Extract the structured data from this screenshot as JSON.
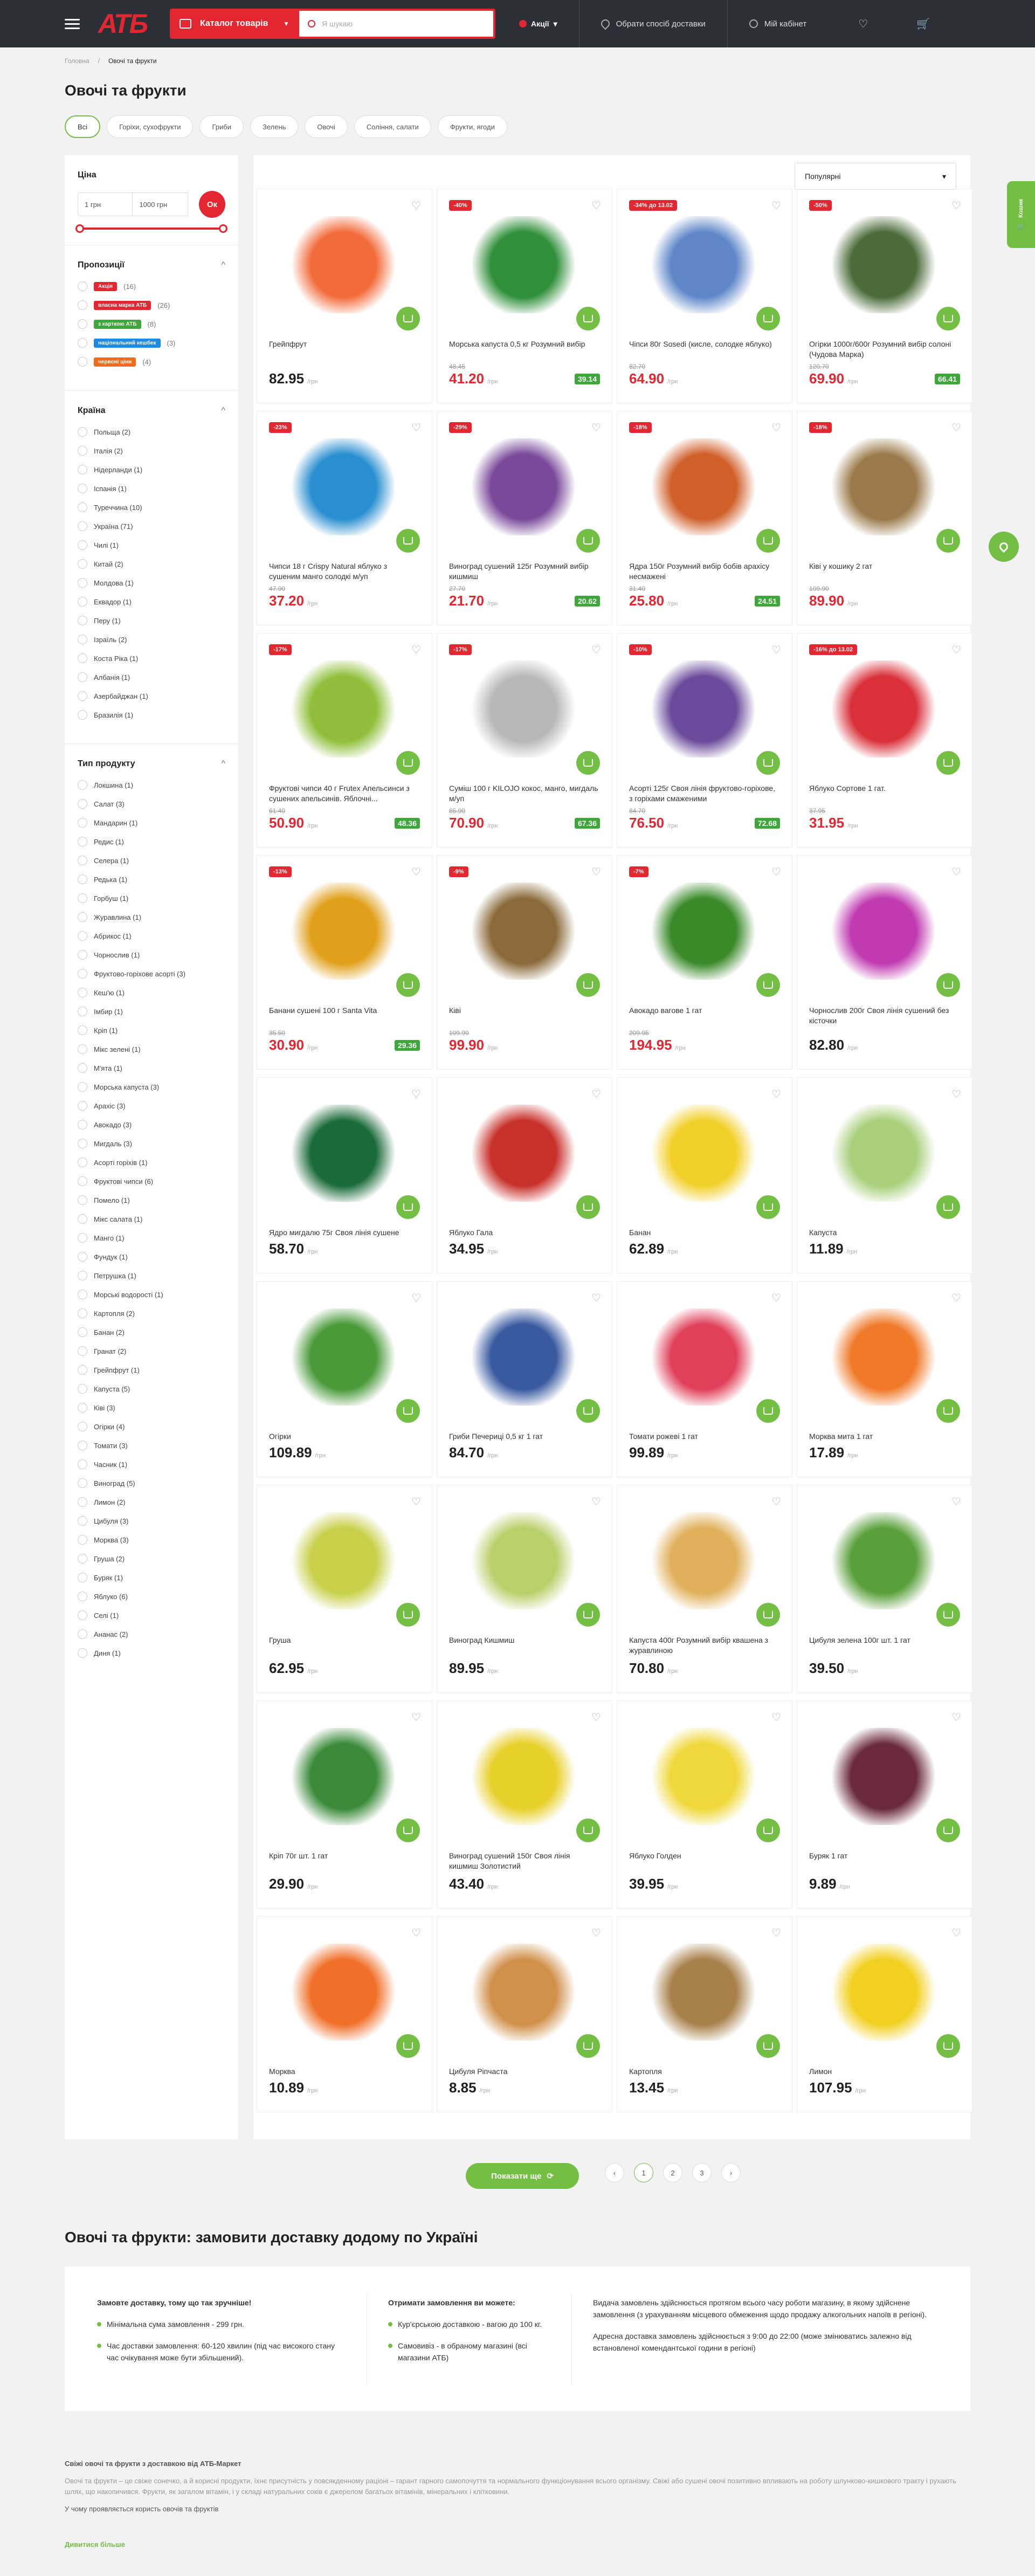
{
  "header": {
    "catalog": "Каталог товарів",
    "search_placeholder": "Я шукаю",
    "promo": "Акції",
    "delivery": "Обрати спосіб доставки",
    "account": "Мій кабінет"
  },
  "breadcrumb": {
    "home": "Головна",
    "current": "Овочі та фрукти"
  },
  "page_title": "Овочі та фрукти",
  "chips": [
    "Всі",
    "Горіхи, сухофрукти",
    "Гриби",
    "Зелень",
    "Овочі",
    "Соління, салати",
    "Фрукти, ягоди"
  ],
  "filters": {
    "price": {
      "title": "Ціна",
      "from": "1 грн",
      "to": "1000 грн",
      "ok": "Ок"
    },
    "offers": {
      "title": "Пропозиції",
      "items": [
        {
          "label": "Акція",
          "count": "(16)"
        },
        {
          "label": "власна марка АТБ",
          "count": "(26)"
        },
        {
          "label": "з карткою АТБ",
          "count": "(8)"
        },
        {
          "label": "національний кешбек",
          "count": "(3)"
        },
        {
          "label": "червоні ціни",
          "count": "(4)"
        }
      ]
    },
    "country": {
      "title": "Країна",
      "items": [
        "Польща (2)",
        "Італія (2)",
        "Нідерланди (1)",
        "Іспанія (1)",
        "Туреччина (10)",
        "Україна (71)",
        "Чилі (1)",
        "Китай (2)",
        "Молдова (1)",
        "Еквадор (1)",
        "Перу (1)",
        "Ізраїль (2)",
        "Коста Ріка (1)",
        "Албанія (1)",
        "Азербайджан (1)",
        "Бразилія (1)"
      ]
    },
    "type": {
      "title": "Тип продукту",
      "items": [
        "Локшина (1)",
        "Салат (3)",
        "Мандарин (1)",
        "Редис (1)",
        "Селера (1)",
        "Редька (1)",
        "Горбуш (1)",
        "Журавлина (1)",
        "Абрикос (1)",
        "Чорнослив (1)",
        "Фруктово-горіхове асорті (3)",
        "Кеш'ю (1)",
        "Імбир (1)",
        "Кріп (1)",
        "Мікс зелені (1)",
        "М'ята (1)",
        "Морська капуста (3)",
        "Арахіс (3)",
        "Авокадо (3)",
        "Мигдаль (3)",
        "Асорті горіхів (1)",
        "Фруктові чипси (6)",
        "Помело (1)",
        "Мікс салата (1)",
        "Манго (1)",
        "Фундук (1)",
        "Петрушка (1)",
        "Морські водорості (1)",
        "Картопля (2)",
        "Банан (2)",
        "Гранат (2)",
        "Грейпфрут (1)",
        "Капуста (5)",
        "Ківі (3)",
        "Огірки (4)",
        "Томати (3)",
        "Часник (1)",
        "Виноград (5)",
        "Лимон (2)",
        "Цибуля (3)",
        "Морква (3)",
        "Груша (2)",
        "Буряк (1)",
        "Яблуко (6)",
        "Селі (1)",
        "Ананас (2)",
        "Диня (1)"
      ]
    }
  },
  "sort": "Популярні",
  "unit": "/грн",
  "products": [
    {
      "name": "Грейпфрут",
      "price": "82.95",
      "color": "#f26b3a"
    },
    {
      "name": "Морська капуста 0,5 кг Розумний вибір",
      "price": "41.20",
      "old": "48.45",
      "atb": "39.14",
      "disc": "-40%",
      "color": "#2f8f3a"
    },
    {
      "name": "Чіпси 80г Sosedi (кисле, солодке яблуко)",
      "price": "64.90",
      "old": "82.70",
      "disc": "-34% до 13.02",
      "color": "#5f87c8"
    },
    {
      "name": "Огірки 1000г/600г Розумний вибір солоні (Чудова Марка)",
      "price": "69.90",
      "old": "120.70",
      "atb": "66.41",
      "disc": "-50%",
      "color": "#4b6b3a"
    },
    {
      "name": "Чипси 18 г Crispy Natural яблуко з сушеним манго солодкі м/уп",
      "price": "37.20",
      "old": "47.90",
      "disc": "-23%",
      "color": "#2a8fd0"
    },
    {
      "name": "Виноград сушений 125г Розумний вибір кишмиш",
      "price": "21.70",
      "old": "27.70",
      "atb": "20.62",
      "disc": "-29%",
      "color": "#7a4a9a"
    },
    {
      "name": "Ядра 150г Розумний вибір бобів арахісу несмажені",
      "price": "25.80",
      "old": "31.40",
      "atb": "24.51",
      "disc": "-18%",
      "color": "#d0602a"
    },
    {
      "name": "Ківі у кошику 2 гат",
      "price": "89.90",
      "old": "109.90",
      "disc": "-18%",
      "color": "#9a7a4a"
    },
    {
      "name": "Фруктові чипси 40 г Frutex Апельсинси з сушених апельсинів. Яблочні...",
      "price": "50.90",
      "old": "61.40",
      "atb": "48.36",
      "disc": "-17%",
      "color": "#8fbf3a"
    },
    {
      "name": "Суміш 100 г KILOJO кокос, манго, мигдаль м/уп",
      "price": "70.90",
      "old": "85.90",
      "atb": "67.36",
      "disc": "-17%",
      "color": "#b8b8b8"
    },
    {
      "name": "Асорті 125г Своя лінія фруктово-горіхове, з горіхами смаженими",
      "price": "76.50",
      "old": "84.70",
      "atb": "72.68",
      "disc": "-10%",
      "color": "#6a4a9a"
    },
    {
      "name": "Яблуко Сортове 1 гат.",
      "price": "31.95",
      "old": "37.95",
      "disc": "-16% до 13.02",
      "color": "#d9303a"
    },
    {
      "name": "Банани сушені 100 г Santa Vita",
      "price": "30.90",
      "old": "35.50",
      "atb": "29.36",
      "disc": "-13%",
      "color": "#e0a01a"
    },
    {
      "name": "Ківі",
      "price": "99.90",
      "old": "109.90",
      "disc": "-9%",
      "color": "#8a6a3a"
    },
    {
      "name": "Авокадо вагове 1 гат",
      "price": "194.95",
      "old": "209.95",
      "disc": "-7%",
      "color": "#3a8a2a"
    },
    {
      "name": "Чорнослив 200г Своя лінія сушений без кісточки",
      "price": "82.80",
      "color": "#c03ab0"
    },
    {
      "name": "Ядро мигдалю 75г Своя лінія сушене",
      "price": "58.70",
      "color": "#1a6a3a"
    },
    {
      "name": "Яблуко Гала",
      "price": "34.95",
      "color": "#c8302a"
    },
    {
      "name": "Банан",
      "price": "62.89",
      "color": "#f2d02a"
    },
    {
      "name": "Капуста",
      "price": "11.89",
      "color": "#a8cf7a"
    },
    {
      "name": "Огірки",
      "price": "109.89",
      "color": "#4a9a3a"
    },
    {
      "name": "Гриби Печериці 0,5 кг 1 гат",
      "price": "84.70",
      "color": "#3a5aa0"
    },
    {
      "name": "Томати рожеві 1 гат",
      "price": "99.89",
      "color": "#e0405a"
    },
    {
      "name": "Морква мита 1 гат",
      "price": "17.89",
      "color": "#f07a2a"
    },
    {
      "name": "Груша",
      "price": "62.95",
      "color": "#c8d04a"
    },
    {
      "name": "Виноград Кишмиш",
      "price": "89.95",
      "color": "#b8d06a"
    },
    {
      "name": "Капуста 400г Розумний вибір квашена з журавлиною",
      "price": "70.80",
      "color": "#e0b05a"
    },
    {
      "name": "Цибуля зелена 100г шт. 1 гат",
      "price": "39.50",
      "color": "#5aa03a"
    },
    {
      "name": "Кріп 70г шт. 1 гат",
      "price": "29.90",
      "color": "#3a8a3a"
    },
    {
      "name": "Виноград сушений 150г Своя лінія кишмиш Золотистий",
      "price": "43.40",
      "color": "#e8d02a"
    },
    {
      "name": "Яблуко Голден",
      "price": "39.95",
      "color": "#f0d83a"
    },
    {
      "name": "Буряк 1 гат",
      "price": "9.89",
      "color": "#6a2a3a"
    },
    {
      "name": "Морква",
      "price": "10.89",
      "color": "#f0702a"
    },
    {
      "name": "Цибуля Ріпчаста",
      "price": "8.85",
      "color": "#d0904a"
    },
    {
      "name": "Картопля",
      "price": "13.45",
      "color": "#a8804a"
    },
    {
      "name": "Лимон",
      "price": "107.95",
      "color": "#f2d020"
    }
  ],
  "show_more": "Показати ще",
  "pages": [
    "1",
    "2",
    "3"
  ],
  "delivery": {
    "title": "Овочі та фрукти: замовити доставку додому по Україні",
    "col1_title": "Замовте доставку, тому що так зручніше!",
    "col1_items": [
      "Мінімальна сума замовлення - 299 грн.",
      "Час доставки замовлення: 60-120 хвилин (під час високого стану час очікування може бути збільшений)."
    ],
    "col2_title": "Отримати замовлення ви можете:",
    "col2_items": [
      "Кур'єрською доставкою - вагою до 100 кг.",
      "Самовивіз - в обраному магазині (всі магазини АТБ)"
    ],
    "col3_p1": "Видача замовлень здійснюється протягом всього часу роботи магазину, в якому здійснене замовлення (з урахуванням місцевого обмеження щодо продажу алкогольних напоїв в регіоні).",
    "col3_p2": "Адресна доставка замовлень здійснюється з 9:00 до 22:00 (може змінюватись залежно від встановленої комендантської години в регіоні)"
  },
  "seo": {
    "heading": "Свіжі овочі та фрукти з доставкою від АТБ-Маркет",
    "text": "Овочі та фрукти – це свіже сонечко, а й корисні продукти, їхнє присутність у повсякденному раціоні – гарант гарного самопочуття та нормального функціонування всього організму. Свіжі або сушені овочі позитивно впливають на роботу шлунково-кишкового тракту і рухають шлях, що накопичився. Фрукти, як загалом вітамін, і у складі натуральних соків є джерелом багатьох вітамінів, мінеральних і клітковини.",
    "sub": "У чому проявляється користь овочів та фруктів",
    "read": "Дивитися більше"
  },
  "sidetab": "Кошик"
}
